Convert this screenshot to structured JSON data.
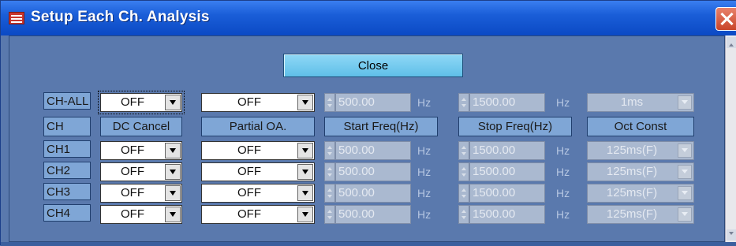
{
  "window": {
    "title": "Setup Each Ch. Analysis"
  },
  "close_button": "Close",
  "headers": {
    "ch": "CH",
    "dc_cancel": "DC Cancel",
    "partial_oa": "Partial OA.",
    "start_freq": "Start Freq(Hz)",
    "stop_freq": "Stop Freq(Hz)",
    "oct_const": "Oct Const"
  },
  "all_row": {
    "label": "CH-ALL",
    "dc_cancel": "OFF",
    "partial_oa": "OFF",
    "start_freq": "500.00",
    "start_unit": "Hz",
    "stop_freq": "1500.00",
    "stop_unit": "Hz",
    "oct_const": "1ms"
  },
  "rows": [
    {
      "label": "CH1",
      "dc_cancel": "OFF",
      "partial_oa": "OFF",
      "start_freq": "500.00",
      "start_unit": "Hz",
      "stop_freq": "1500.00",
      "stop_unit": "Hz",
      "oct_const": "125ms(F)"
    },
    {
      "label": "CH2",
      "dc_cancel": "OFF",
      "partial_oa": "OFF",
      "start_freq": "500.00",
      "start_unit": "Hz",
      "stop_freq": "1500.00",
      "stop_unit": "Hz",
      "oct_const": "125ms(F)"
    },
    {
      "label": "CH3",
      "dc_cancel": "OFF",
      "partial_oa": "OFF",
      "start_freq": "500.00",
      "start_unit": "Hz",
      "stop_freq": "1500.00",
      "stop_unit": "Hz",
      "oct_const": "125ms(F)"
    },
    {
      "label": "CH4",
      "dc_cancel": "OFF",
      "partial_oa": "OFF",
      "start_freq": "500.00",
      "start_unit": "Hz",
      "stop_freq": "1500.00",
      "stop_unit": "Hz",
      "oct_const": "125ms(F)"
    }
  ],
  "icons": {
    "title": "app-window-icon",
    "close": "close-x-icon",
    "dropdown": "chevron-down-icon",
    "spinner": "spinner-icon"
  },
  "colors": {
    "titlebar": "#1a5ed8",
    "background": "#5a79ad",
    "close_button": "#6ac6ec",
    "label_bg": "#7fa6d6"
  }
}
